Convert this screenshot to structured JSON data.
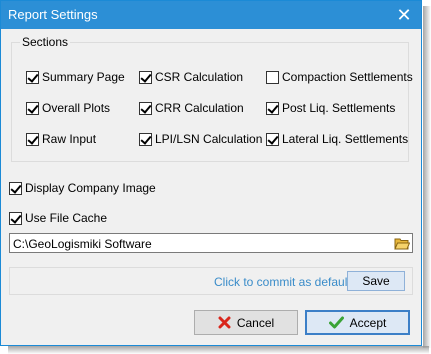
{
  "window": {
    "title": "Report Settings",
    "close_glyph": "✕"
  },
  "sections": {
    "label": "Sections",
    "options": [
      {
        "label": "Summary Page",
        "checked": true
      },
      {
        "label": "CSR Calculation",
        "checked": true
      },
      {
        "label": "Compaction Settlements",
        "checked": false
      },
      {
        "label": "Overall Plots",
        "checked": true
      },
      {
        "label": "CRR Calculation",
        "checked": true
      },
      {
        "label": "Post Liq. Settlements",
        "checked": true
      },
      {
        "label": "Raw Input",
        "checked": true
      },
      {
        "label": "LPI/LSN Calculation",
        "checked": true
      },
      {
        "label": "Lateral Liq. Settlements",
        "checked": true
      }
    ]
  },
  "display_company_image": {
    "label": "Display Company Image",
    "checked": true
  },
  "use_file_cache": {
    "label": "Use File Cache",
    "checked": true
  },
  "cache_path": {
    "value": "C:\\GeoLogismiki Software"
  },
  "default_panel": {
    "hint": "Click to commit as default",
    "save_label": "Save"
  },
  "footer": {
    "cancel_label": "Cancel",
    "accept_label": "Accept"
  },
  "colors": {
    "titlebar": "#2c8fd6",
    "hint": "#3a8cc9",
    "cancel_icon": "#d9261c",
    "accept_icon": "#3aa336"
  },
  "icons": {
    "close": "close-icon",
    "folder": "folder-open-icon",
    "cancel": "x-icon",
    "accept": "checkmark-icon"
  }
}
